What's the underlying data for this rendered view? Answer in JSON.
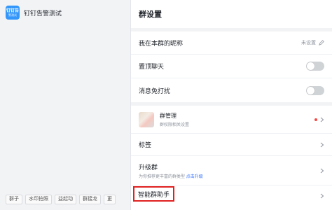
{
  "chat": {
    "avatar_line1": "钉钉告",
    "avatar_line2": "警测试",
    "title": "钉钉告警测试",
    "toolbar": [
      "群子",
      "水印拍照",
      "益起动",
      "群接龙",
      "更"
    ]
  },
  "panel": {
    "title": "群设置",
    "nickname": {
      "label": "我在本群的昵称",
      "value": "未设置"
    },
    "pin": {
      "label": "置顶聊天",
      "on": false
    },
    "mute": {
      "label": "消息免打扰",
      "on": false
    },
    "manage": {
      "title": "群管理",
      "subtitle": "群权限相关设置"
    },
    "tags": {
      "label": "标签"
    },
    "upgrade": {
      "label": "升级群",
      "desc": "为你推荐更丰富的群类型",
      "link": "点击升级"
    },
    "assistant": {
      "label": "智能群助手"
    }
  },
  "colors": {
    "accent": "#3370ff",
    "highlight": "#e02020",
    "badge": "#f54a45"
  }
}
